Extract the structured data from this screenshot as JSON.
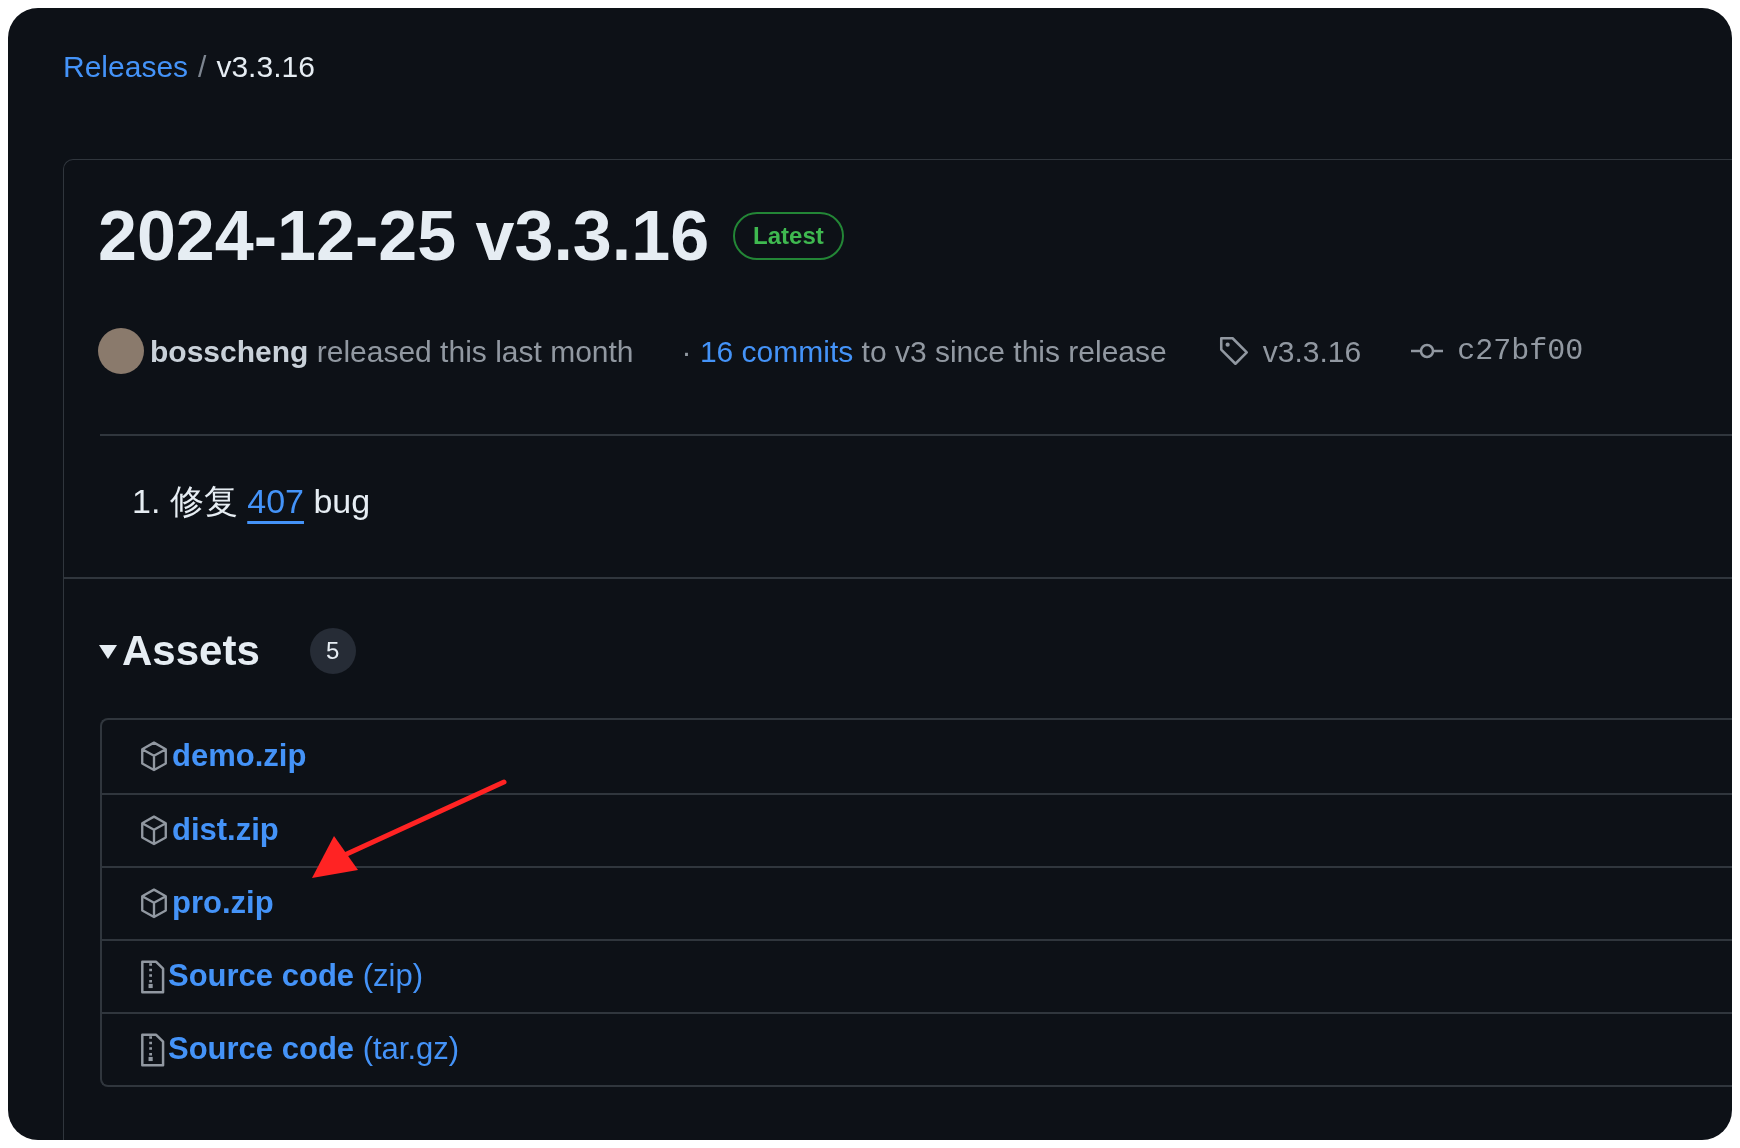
{
  "breadcrumb": {
    "parent": "Releases",
    "separator": "/",
    "current": "v3.3.16"
  },
  "release": {
    "title": "2024-12-25 v3.3.16",
    "badge": "Latest",
    "author": "bosscheng",
    "released_text": "released this last month",
    "commits_prefix": "·",
    "commits_link": "16 commits",
    "commits_suffix": "to v3 since this release",
    "tag": "v3.3.16",
    "commit": "c27bf00"
  },
  "notes": [
    {
      "number": "1.",
      "text": "修复",
      "link": "407",
      "after": "bug"
    }
  ],
  "assets": {
    "title": "Assets",
    "count": "5",
    "expanded": true,
    "items": [
      {
        "kind": "package",
        "name": "demo.zip"
      },
      {
        "kind": "package",
        "name": "dist.zip"
      },
      {
        "kind": "package",
        "name": "pro.zip"
      },
      {
        "kind": "source",
        "name": "Source code",
        "suffix": "(zip)"
      },
      {
        "kind": "source",
        "name": "Source code",
        "suffix": "(tar.gz)"
      }
    ]
  },
  "annotations": [
    {
      "kind": "arrow",
      "color": "#ff2323"
    }
  ]
}
